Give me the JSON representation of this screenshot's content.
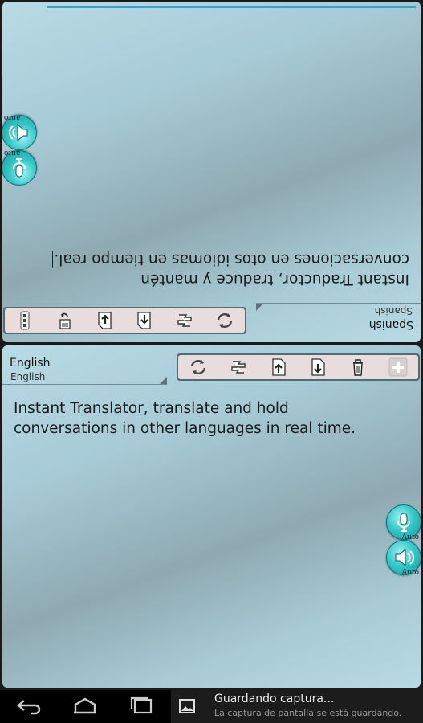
{
  "top_panel": {
    "language": "Spanish",
    "language_sub": "Spanish",
    "text_line1": "Instant Traductor, traduce y mantén",
    "text_line2": "conversaciones en otos idiomas en tiempo real.",
    "side_tag_top": "auto",
    "side_tag_bottom": "auto",
    "toolbar_icons": [
      "refresh-icon",
      "swap-icon",
      "import-icon",
      "export-icon",
      "paste-icon",
      "menu-icon"
    ]
  },
  "bottom_panel": {
    "language": "English",
    "language_sub": "English",
    "text_line1": "Instant Translator, translate and hold",
    "text_line2": "conversations in other languages in real time.",
    "side_tag_mic": "Auto",
    "side_tag_speaker": "Auto",
    "toolbar_icons": [
      "refresh-icon",
      "swap-icon",
      "import-icon",
      "export-icon",
      "trash-icon",
      "plus-icon"
    ]
  },
  "notification": {
    "title": "Guardando captura...",
    "subtitle": "La captura de pantalla se está guardando."
  },
  "colors": {
    "accent": "#37a3c8",
    "button_teal": "#35c8c8",
    "toolbar_bg": "#e8dcdc"
  }
}
